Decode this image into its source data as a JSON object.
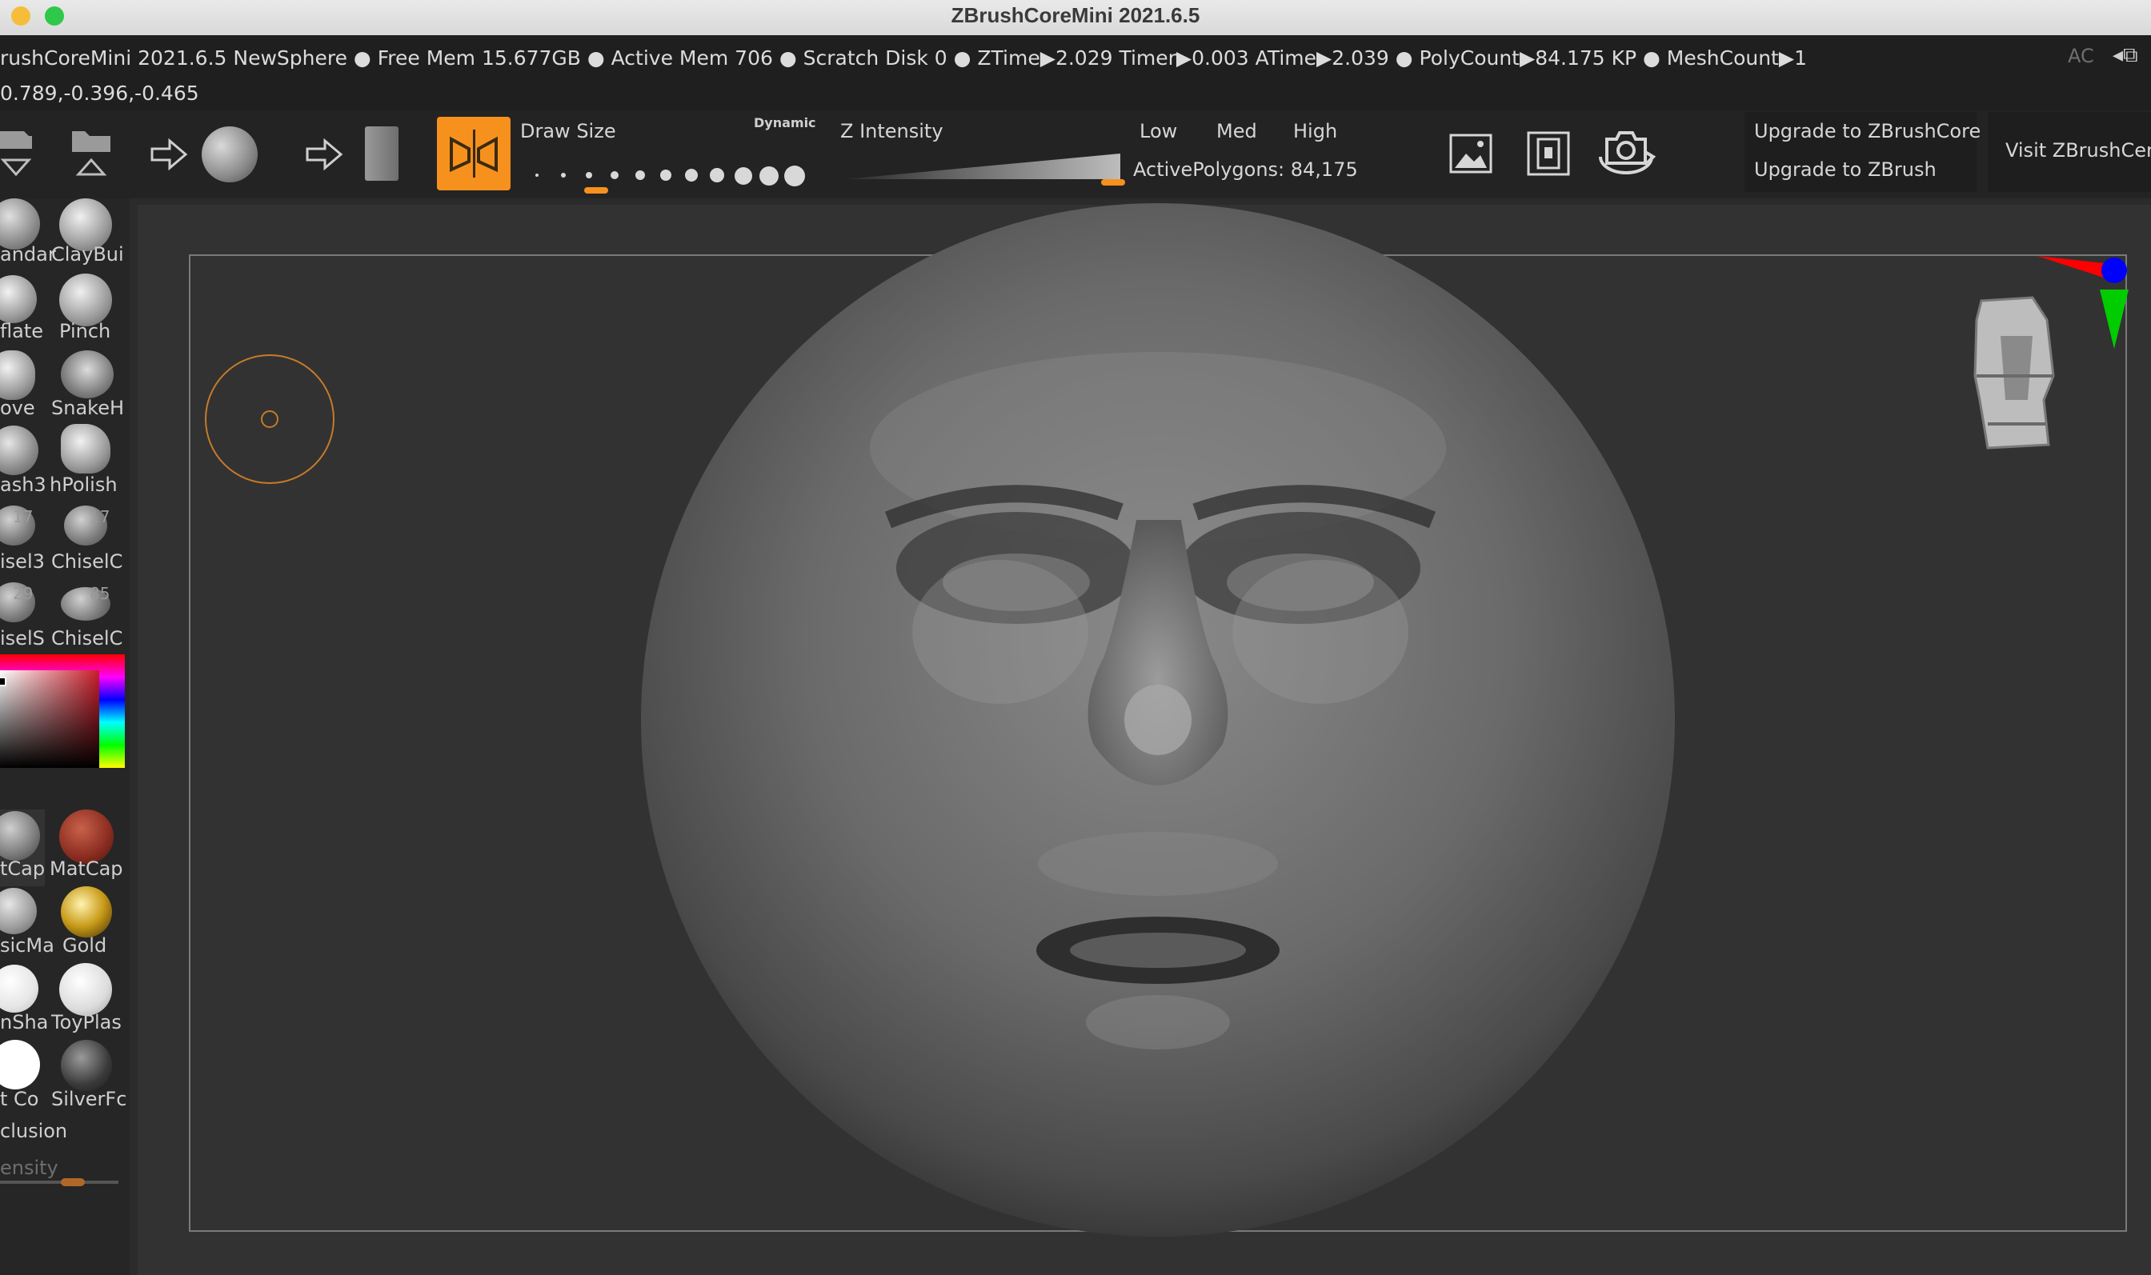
{
  "window": {
    "title": "ZBrushCoreMini 2021.6.5"
  },
  "status": {
    "text": "rushCoreMini 2021.6.5 NewSphere   ● Free Mem 15.677GB ● Active Mem 706 ● Scratch Disk 0 ●  ZTime▶2.029 Timer▶0.003 ATime▶2.039 ● PolyCount▶84.175 KP  ● MeshCount▶1",
    "ac": "AC",
    "coords": "0.789,-0.396,-0.465"
  },
  "toolbar": {
    "draw_size_label": "Draw Size",
    "dynamic_label": "Dynamic",
    "z_intensity_label": "Z Intensity",
    "low_label": "Low",
    "med_label": "Med",
    "high_label": "High",
    "active_polygons": "ActivePolygons: 84,175",
    "upgrade_core": "Upgrade to ZBrushCore",
    "upgrade_zbrush": "Upgrade to ZBrush",
    "visit_center": "Visit ZBrushCen",
    "draw_size_level": 0.25,
    "z_intensity_level": 1.0
  },
  "brushes": [
    {
      "label": "andar"
    },
    {
      "label": "ClayBui"
    },
    {
      "label": "flate"
    },
    {
      "label": "Pinch"
    },
    {
      "label": "ove"
    },
    {
      "label": "SnakeH"
    },
    {
      "label": "ash3"
    },
    {
      "label": "hPolish"
    },
    {
      "label": "isel3",
      "badge": "17"
    },
    {
      "label": "ChiselC",
      "badge": "17"
    },
    {
      "label": "iselS",
      "badge": "29"
    },
    {
      "label": "ChiselC",
      "badge": "85"
    }
  ],
  "materials": [
    {
      "label": "tCap"
    },
    {
      "label": "MatCap"
    },
    {
      "label": "sicMa"
    },
    {
      "label": "Gold"
    },
    {
      "label": "nSha"
    },
    {
      "label": "ToyPlas"
    },
    {
      "label": "t Co"
    },
    {
      "label": "SilverFc"
    }
  ],
  "shelf": {
    "occlusion_label": "clusion",
    "intensity_label": "ensity"
  },
  "colors": {
    "accent": "#f7911e",
    "active_bg": "#f7911e",
    "axis_x": "#ff0000",
    "axis_y": "#00cc00",
    "axis_z": "#0000ff"
  }
}
